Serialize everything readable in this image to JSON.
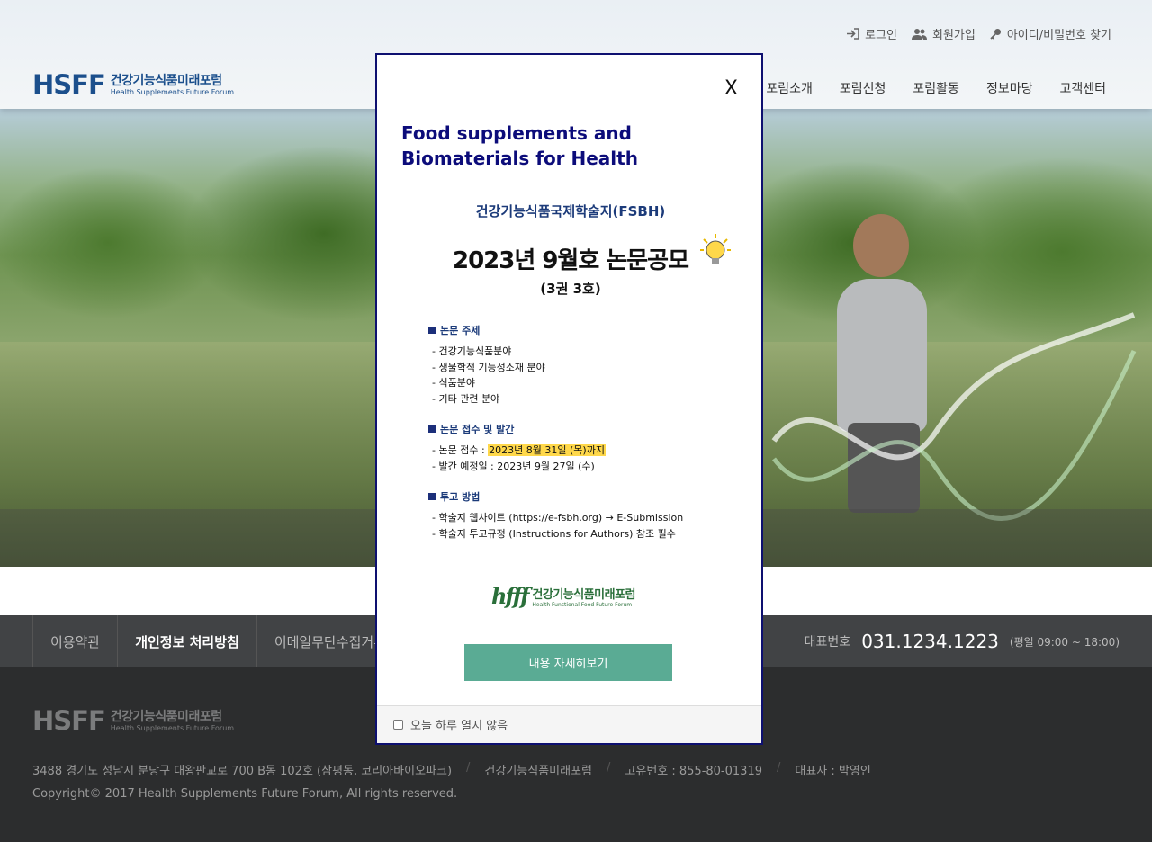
{
  "header": {
    "util_links": [
      "로그인",
      "회원가입",
      "아이디/비밀번호 찾기"
    ],
    "logo": {
      "mark": "HSFF",
      "ko": "건강기능식품미래포럼",
      "en": "Health Supplements Future Forum"
    },
    "nav": [
      "포럼소개",
      "포럼신청",
      "포럼활동",
      "정보마당",
      "고객센터"
    ]
  },
  "popup": {
    "close": "X",
    "title": "Food supplements and Biomaterials for Health",
    "poster": {
      "journal": "건강기능식품국제학술지(FSBH)",
      "headline": "2023년 9월호 논문공모",
      "volume": "(3권 3호)",
      "sections": [
        {
          "heading": "논문 주제",
          "items": [
            "- 건강기능식품분야",
            "- 생물학적 기능성소재 분야",
            "- 식품분야",
            "- 기타 관련 분야"
          ]
        },
        {
          "heading": "논문 접수 및 발간",
          "items": []
        },
        {
          "heading": "투고 방법",
          "items": [
            "- 학술지 웹사이트 (https://e-fsbh.org) → E-Submission",
            "- 학술지 투고규정 (Instructions for Authors) 참조 필수"
          ]
        }
      ],
      "receipt_prefix": "- 논문 접수 : ",
      "receipt_date": "2023년 8월 31일 (목)까지",
      "publish": "- 발간 예정일 : 2023년 9월 27일 (수)",
      "logo_mark": "hfff",
      "logo_ko": "건강기능식품미래포럼",
      "logo_en": "Health Functional Food Future Forum"
    },
    "detail_button": "내용 자세히보기",
    "dont_show_today": "오늘 하루 열지 않음"
  },
  "footer": {
    "links": [
      "이용약관",
      "개인정보 처리방침",
      "이메일무단수집거부"
    ],
    "phone_label": "대표번호",
    "phone": "031.1234.1223",
    "hours": "(평일 09:00 ~ 18:00)",
    "logo": {
      "mark": "HSFF",
      "ko": "건강기능식품미래포럼",
      "en": "Health Supplements Future Forum"
    },
    "address": "3488 경기도 성남시 분당구 대왕판교로 700 B동 102호 (삼평동, 코리아바이오파크)",
    "org": "건강기능식품미래포럼",
    "reg_no": "고유번호 : 855-80-01319",
    "ceo": "대표자 : 박영인",
    "copyright": "Copyright© 2017 Health Supplements Future Forum, All rights reserved."
  },
  "colors": {
    "brand": "#1b4f8c",
    "popup_border": "#0e1070",
    "popup_title": "#0c0c7a",
    "button": "#5aab94",
    "highlight": "#ffd84a"
  }
}
